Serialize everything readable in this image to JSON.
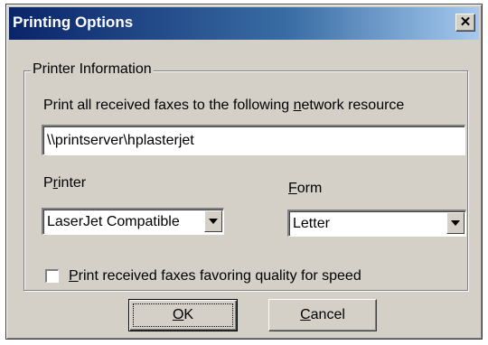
{
  "dialog": {
    "title": "Printing Options",
    "close_glyph": "✕"
  },
  "group": {
    "legend": "Printer Information",
    "instruction_prefix": "Print all received faxes to the following ",
    "instruction_mnemonic": "n",
    "instruction_suffix": "etwork resource",
    "network_resource_value": "\\\\printserver\\hplasterjet"
  },
  "printer": {
    "label_pre": "P",
    "label_mnemonic": "r",
    "label_post": "inter",
    "selected": "LaserJet Compatible"
  },
  "form": {
    "label_mnemonic": "F",
    "label_post": "orm",
    "selected": "Letter"
  },
  "quality": {
    "label_mnemonic": "P",
    "label_post": "rint received faxes favoring quality for speed",
    "checked": false
  },
  "buttons": {
    "ok_mnemonic": "O",
    "ok_post": "K",
    "cancel_mnemonic": "C",
    "cancel_post": "ancel"
  }
}
